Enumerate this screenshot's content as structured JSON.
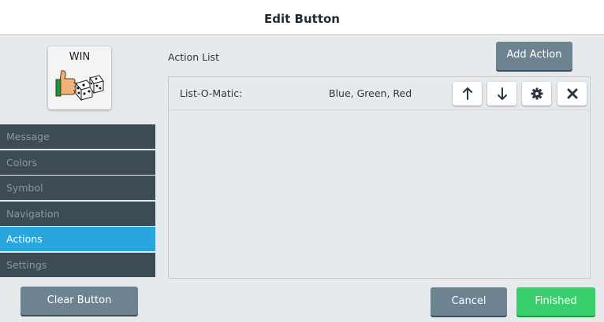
{
  "dialog": {
    "title": "Edit Button"
  },
  "preview": {
    "label": "WIN",
    "symbol_icon": "thumbs-up-dice-icon"
  },
  "sidebar": {
    "items": [
      {
        "label": "Message",
        "active": false
      },
      {
        "label": "Colors",
        "active": false
      },
      {
        "label": "Symbol",
        "active": false
      },
      {
        "label": "Navigation",
        "active": false
      },
      {
        "label": "Actions",
        "active": true
      },
      {
        "label": "Settings",
        "active": false
      }
    ],
    "clear_label": "Clear Button"
  },
  "main": {
    "action_list_label": "Action List",
    "add_action_label": "Add Action",
    "actions": [
      {
        "name": "List-O-Matic:",
        "value": "Blue, Green, Red"
      }
    ],
    "row_buttons": [
      "arrow-up-icon",
      "arrow-down-icon",
      "gear-icon",
      "close-icon"
    ]
  },
  "footer": {
    "cancel_label": "Cancel",
    "finished_label": "Finished"
  },
  "colors": {
    "nav_bg": "#3c4b54",
    "nav_active": "#2aa6df",
    "panel_bg": "#e7eaed",
    "button_gray": "#6d8391",
    "finished_green": "#39cf6d"
  }
}
